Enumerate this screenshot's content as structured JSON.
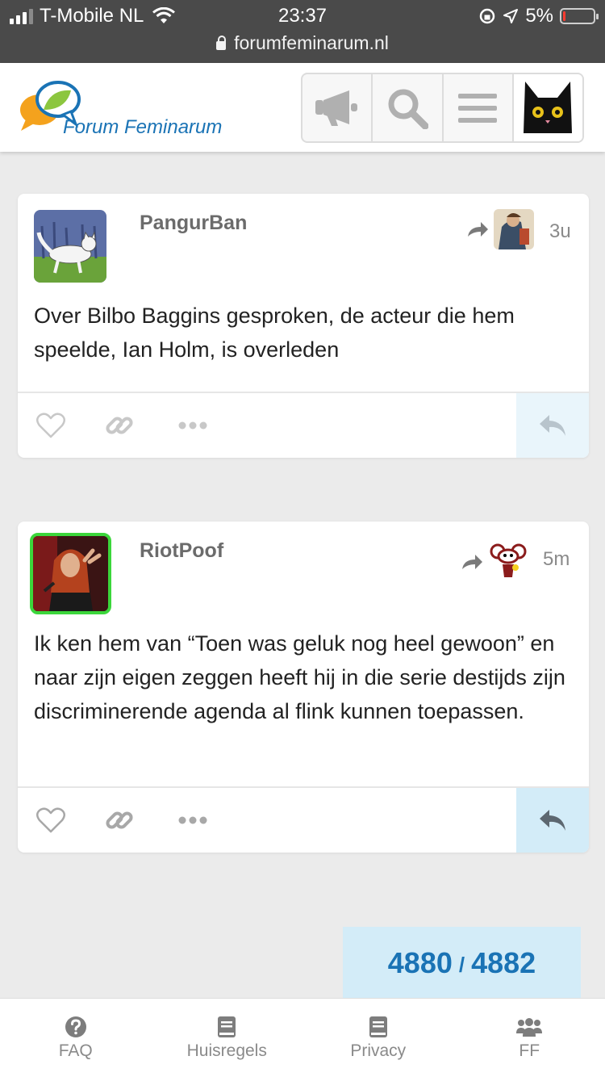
{
  "status_bar": {
    "carrier": "T-Mobile NL",
    "time": "23:37",
    "battery": "5%",
    "battery_level": 0.05,
    "url": "forumfeminarum.nl"
  },
  "header": {
    "logo_text": "Forum Feminarum",
    "icons": [
      "megaphone-icon",
      "search-icon",
      "menu-icon",
      "user-avatar"
    ]
  },
  "posts": [
    {
      "username": "PangurBan",
      "age": "3u",
      "text": "Over Bilbo Baggins gesproken, de acteur die hem speelde, Ian Holm, is overleden"
    },
    {
      "username": "RiotPoof",
      "age": "5m",
      "text": "Ik ken hem van “Toen was geluk nog heel gewoon” en naar zijn eigen zeggen heeft hij in die serie destijds zijn discriminerende agenda al flink kunnen toepassen."
    }
  ],
  "progress": {
    "current": "4880",
    "separator": "/",
    "total": "4882"
  },
  "footer": {
    "items": [
      {
        "label": "FAQ",
        "icon": "question-icon"
      },
      {
        "label": "Huisregels",
        "icon": "book-icon"
      },
      {
        "label": "Privacy",
        "icon": "book-icon"
      },
      {
        "label": "FF",
        "icon": "users-icon"
      }
    ]
  },
  "colors": {
    "accent": "#1a73b5",
    "highlight": "#d3ecf8",
    "online": "#3bd63b"
  }
}
